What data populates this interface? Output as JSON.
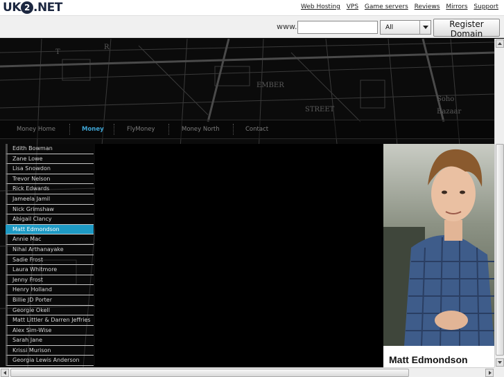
{
  "header": {
    "logo_text_left": "UK",
    "logo_text_mid": "2",
    "logo_text_right": ".NET",
    "links": [
      "Web Hosting",
      "VPS",
      "Game servers",
      "Reviews",
      "Mirrors",
      "Support"
    ]
  },
  "register": {
    "prefix": "www.",
    "input_value": "",
    "tld_selected": "All",
    "button_label": "Register Domain"
  },
  "nav": {
    "items": [
      "Money Home",
      "Money",
      "FlyMoney",
      "Money North",
      "Contact"
    ],
    "active": "Money"
  },
  "sidebar": {
    "items": [
      "Edith Bowman",
      "Zane Lowe",
      "Lisa Snowdon",
      "Trevor Nelson",
      "Rick Edwards",
      "Jameela Jamil",
      "Nick Grimshaw",
      "Abigail Clancy",
      "Matt Edmondson",
      "Annie Mac",
      "Nihal Arthanayake",
      "Sadie Frost",
      "Laura Whitmore",
      "Jenny Frost",
      "Henry Holland",
      "Billie JD Porter",
      "Georgie Okell",
      "Matt Littler & Darren Jeffries",
      "Alex Sim-Wise",
      "Sarah Jane",
      "Krissi Murison",
      "Georgia Lewis Anderson"
    ],
    "active_index": 8
  },
  "profile": {
    "name": "Matt Edmondson"
  },
  "colors": {
    "accent": "#1e9ac4",
    "nav_active": "#3fa6d6",
    "background": "#0b0b0b"
  }
}
